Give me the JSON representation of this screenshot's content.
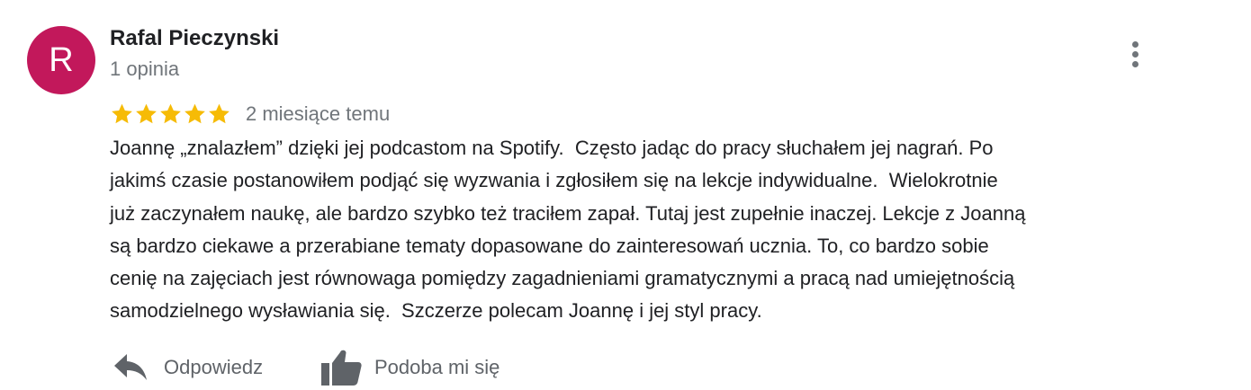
{
  "reviewer": {
    "avatar_letter": "R",
    "avatar_color": "#c2185b",
    "name": "Rafal Pieczynski",
    "review_count": "1 opinia"
  },
  "rating": {
    "stars": 5,
    "max_stars": 5,
    "star_color": "#f6bb06",
    "date": "2 miesiące temu"
  },
  "review": {
    "text_lines": [
      "Joannę „znalazłem” dzięki jej podcastom na Spotify.  Często jadąc do pracy słuchałem jej nagrań. Po",
      "jakimś czasie postanowiłem podjąć się wyzwania i zgłosiłem się na lekcje indywidualne.  Wielokrotnie",
      "już zaczynałem naukę, ale bardzo szybko też traciłem zapał. Tutaj jest zupełnie inaczej. Lekcje z Joanną",
      "są bardzo ciekawe a przerabiane tematy dopasowane do zainteresowań ucznia. To, co bardzo sobie",
      "cenię na zajęciach jest równowaga pomiędzy zagadnieniami gramatycznymi a pracą nad umiejętnością",
      "samodzielnego wysławiania się.  Szczerze polecam Joannę i jej styl pracy."
    ]
  },
  "actions": {
    "reply_label": "Odpowiedz",
    "reply_icon": "reply-arrow-icon",
    "like_label": "Podoba mi się",
    "like_icon": "thumbs-up-icon",
    "more_icon": "more-vertical-icon"
  }
}
